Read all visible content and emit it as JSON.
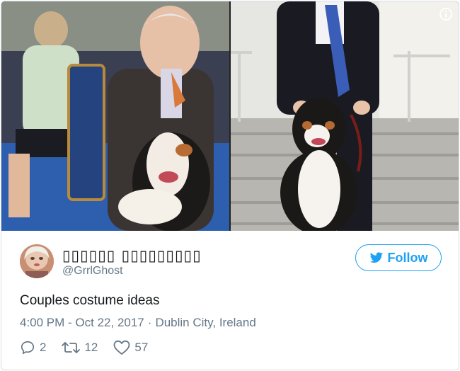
{
  "tweet": {
    "display_name": "▯▯▯▯▯▯ ▯▯▯▯▯▯▯▯▯",
    "handle": "@GrrlGhost",
    "text": "Couples costume ideas",
    "time": "4:00 PM - Oct 22, 2017",
    "separator": "·",
    "location": "Dublin City, Ireland",
    "replies": "2",
    "retweets": "12",
    "likes": "57"
  },
  "follow_button": {
    "label": "Follow"
  },
  "icons": {
    "info": "info-icon",
    "bird": "twitter-bird-icon",
    "reply": "reply-icon",
    "retweet": "retweet-icon",
    "like": "heart-icon"
  },
  "colors": {
    "accent": "#1da1f2",
    "secondary_text": "#657786",
    "primary_text": "#14171a",
    "border": "#d8dee3"
  }
}
